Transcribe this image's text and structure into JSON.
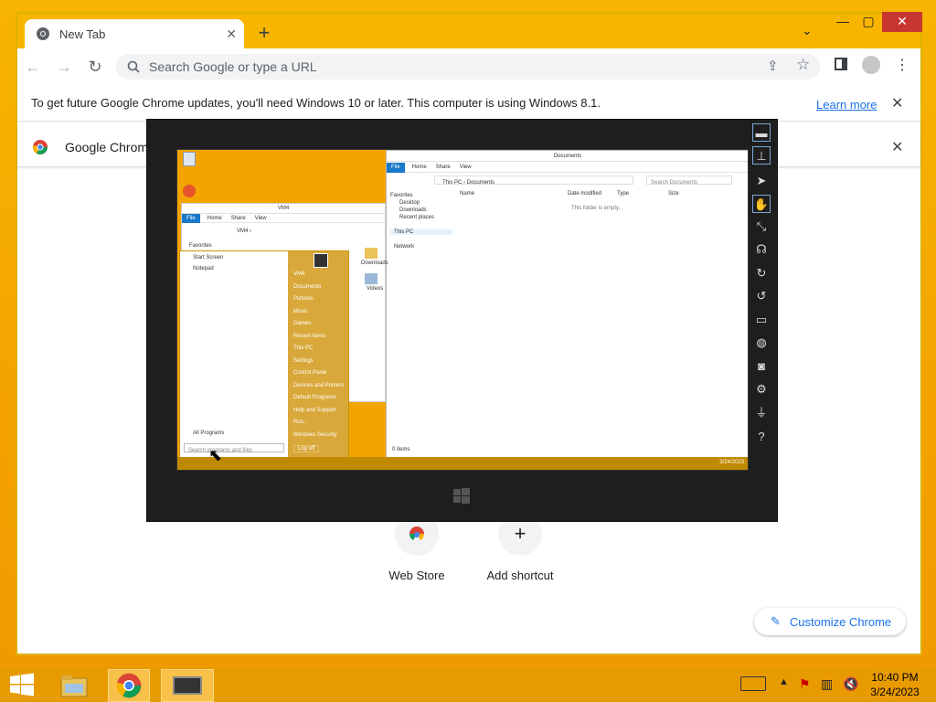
{
  "browser": {
    "tab_title": "New Tab",
    "omnibox_placeholder": "Search Google or type a URL",
    "infobar_message": "To get future Google Chrome updates, you'll need Windows 10 or later. This computer is using Windows 8.1.",
    "infobar_link": "Learn more",
    "notification_label": "Google Chrome",
    "shortcuts": [
      {
        "label": "Web Store"
      },
      {
        "label": "Add shortcut"
      }
    ],
    "customize_label": "Customize Chrome"
  },
  "remote_desktop": {
    "documents_window": {
      "title": "Documents",
      "ribbon_tabs": [
        "File",
        "Home",
        "Share",
        "View"
      ],
      "path": "This PC  ›  Documents",
      "search_placeholder": "Search Documents",
      "columns": [
        "Name",
        "Date modified",
        "Type",
        "Size"
      ],
      "empty_message": "This folder is empty.",
      "nav_items": [
        "Favorites",
        "Desktop",
        "Downloads",
        "Recent places",
        "This PC",
        "Network"
      ],
      "status": "0 items"
    },
    "vm4_window": {
      "title": "VM4",
      "ribbon_tabs": [
        "File",
        "Home",
        "Share",
        "View"
      ],
      "path": "VM4  ›",
      "nav_items": [
        "Favorites"
      ],
      "folders": [
        "Downloads",
        "Videos"
      ]
    },
    "start_menu": {
      "pinned": [
        "Start Screen",
        "Notepad"
      ],
      "all_programs": "All Programs",
      "search_placeholder": "Search programs and files",
      "right_items": [
        "VM4",
        "Documents",
        "Pictures",
        "Music",
        "Games",
        "Recent Items",
        "This PC",
        "Settings",
        "Control Panel",
        "Devices and Printers",
        "Default Programs",
        "Help and Support",
        "Run...",
        "Windows Security"
      ],
      "logoff": "Log off"
    },
    "desktop_icons": [
      "Recycle Bin",
      "Firefox"
    ],
    "clock": "3/24/2023"
  },
  "taskbar": {
    "time": "10:40 PM",
    "date": "3/24/2023"
  },
  "colors": {
    "desktop": "#f4a300",
    "accent_link": "#1a73e8",
    "close_red": "#c7372f"
  }
}
